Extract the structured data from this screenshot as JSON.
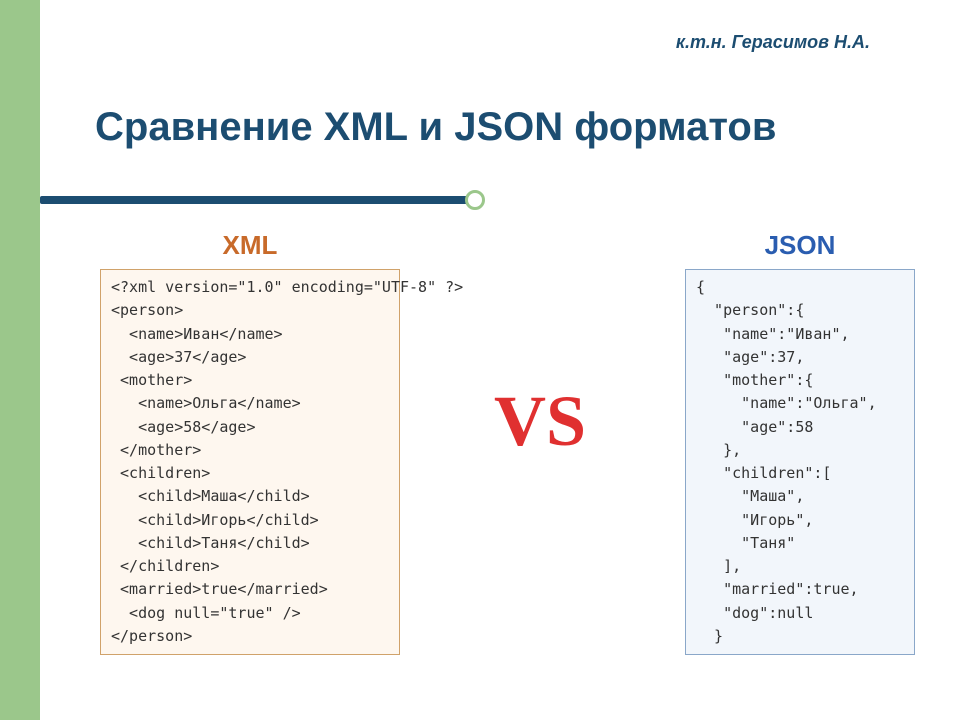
{
  "author": "к.т.н. Герасимов Н.А.",
  "title": "Сравнение XML и JSON форматов",
  "xml": {
    "heading": "XML",
    "code": "<?xml version=\"1.0\" encoding=\"UTF-8\" ?>\n<person>\n  <name>Иван</name>\n  <age>37</age>\n <mother>\n   <name>Ольга</name>\n   <age>58</age>\n </mother>\n <children>\n   <child>Маша</child>\n   <child>Игорь</child>\n   <child>Таня</child>\n </children>\n <married>true</married>\n  <dog null=\"true\" />\n</person>"
  },
  "vs": "VS",
  "json": {
    "heading": "JSON",
    "code": "{\n  \"person\":{\n   \"name\":\"Иван\",\n   \"age\":37,\n   \"mother\":{\n     \"name\":\"Ольга\",\n     \"age\":58\n   },\n   \"children\":[\n     \"Маша\",\n     \"Игорь\",\n     \"Таня\"\n   ],\n   \"married\":true,\n   \"dog\":null\n  }"
  }
}
